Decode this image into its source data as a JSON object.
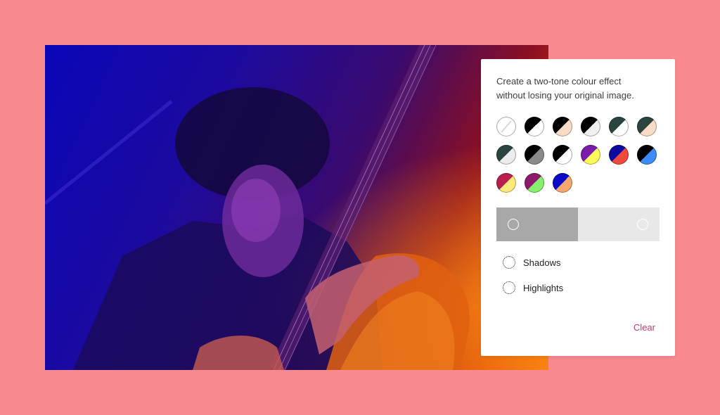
{
  "panel": {
    "description": "Create a two-tone colour effect without losing your original image.",
    "swatches": [
      {
        "name": "none",
        "a": "#ffffff",
        "b": "#ffffff",
        "slash": true
      },
      {
        "name": "black-white",
        "a": "#000000",
        "b": "#ffffff"
      },
      {
        "name": "black-peach",
        "a": "#000000",
        "b": "#f8dcc6"
      },
      {
        "name": "black-lightgrey",
        "a": "#000000",
        "b": "#f0f0f0"
      },
      {
        "name": "darkgreen-white",
        "a": "#2c4440",
        "b": "#ffffff"
      },
      {
        "name": "darkgreen-peach",
        "a": "#2c4440",
        "b": "#f8dcc6"
      },
      {
        "name": "darkgreen-lightgrey",
        "a": "#2c4440",
        "b": "#ececec"
      },
      {
        "name": "black-grey",
        "a": "#000000",
        "b": "#8a8a8a"
      },
      {
        "name": "black-white-2",
        "a": "#000000",
        "b": "#ffffff"
      },
      {
        "name": "purple-yellow",
        "a": "#7a1dae",
        "b": "#fbf85a"
      },
      {
        "name": "navy-red",
        "a": "#0d0a9f",
        "b": "#ee4a3d"
      },
      {
        "name": "black-blue",
        "a": "#000000",
        "b": "#3b8cf6"
      },
      {
        "name": "crimson-yellow",
        "a": "#b81f4d",
        "b": "#fbe97c"
      },
      {
        "name": "magenta-green",
        "a": "#8c1b6b",
        "b": "#86f06c"
      },
      {
        "name": "blue-orange",
        "a": "#0b08c7",
        "b": "#f4a86e"
      }
    ],
    "preview": {
      "shadow_color": "#a8a8a8",
      "highlight_color": "#e8e8e8"
    },
    "shadows_label": "Shadows",
    "highlights_label": "Highlights",
    "clear_label": "Clear"
  },
  "colors": {
    "background": "#f7898f",
    "accent": "#c6386f"
  }
}
